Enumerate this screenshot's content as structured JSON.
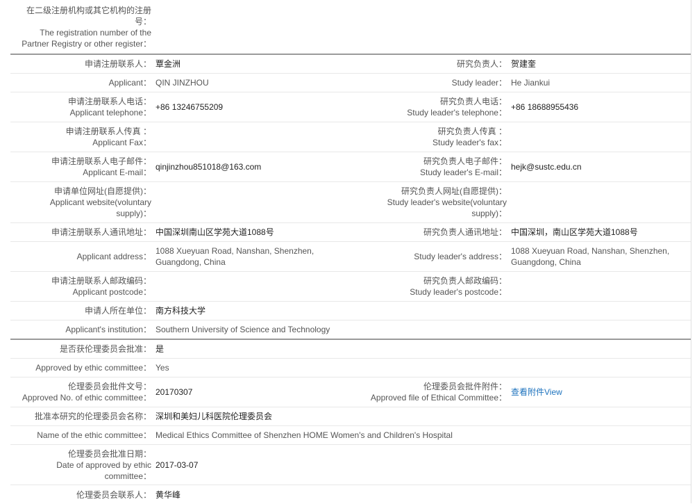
{
  "rows": [
    {
      "l1": [
        "在二级注册机构或其它机构的注册",
        "号：",
        "The registration number of the",
        "Partner Registry or other register："
      ],
      "v1": ""
    },
    {
      "l1": [
        "申请注册联系人："
      ],
      "v1": "覃金洲",
      "l2": [
        "研究负责人："
      ],
      "v2": "贺建奎"
    },
    {
      "l1": [
        "Applicant："
      ],
      "v1": "QIN JINZHOU",
      "l2": [
        "Study leader："
      ],
      "v2": "He Jiankui"
    },
    {
      "l1": [
        "申请注册联系人电话：",
        "Applicant telephone："
      ],
      "v1": "+86 13246755209",
      "l2": [
        "研究负责人电话：",
        "Study leader's telephone："
      ],
      "v2": "+86 18688955436"
    },
    {
      "l1": [
        "申请注册联系人传真 ：",
        "Applicant Fax："
      ],
      "v1": "",
      "l2": [
        "研究负责人传真 ：",
        "Study leader's fax："
      ],
      "v2": ""
    },
    {
      "l1": [
        "申请注册联系人电子邮件：",
        "Applicant E-mail："
      ],
      "v1": "qinjinzhou851018@163.com",
      "l2": [
        "研究负责人电子邮件：",
        "Study leader's E-mail："
      ],
      "v2": "hejk@sustc.edu.cn"
    },
    {
      "l1": [
        "申请单位网址(自愿提供)：",
        "Applicant website(voluntary",
        "supply)："
      ],
      "v1": "",
      "l2": [
        "研究负责人网址(自愿提供)：",
        "Study leader's website(voluntary",
        "supply)："
      ],
      "v2": ""
    },
    {
      "l1": [
        "申请注册联系人通讯地址："
      ],
      "v1": "中国深圳南山区学苑大道1088号",
      "l2": [
        "研究负责人通讯地址："
      ],
      "v2": "中国深圳，南山区学苑大道1088号"
    },
    {
      "l1": [
        "Applicant address："
      ],
      "v1": "1088 Xueyuan Road, Nanshan, Shenzhen, Guangdong, China",
      "l2": [
        "Study leader's address："
      ],
      "v2": "1088 Xueyuan Road, Nanshan, Shenzhen, Guangdong, China"
    },
    {
      "l1": [
        "申请注册联系人邮政编码：",
        "Applicant postcode："
      ],
      "v1": "",
      "l2": [
        "研究负责人邮政编码：",
        "Study leader's postcode："
      ],
      "v2": ""
    },
    {
      "l1": [
        "申请人所在单位："
      ],
      "v1": "南方科技大学"
    },
    {
      "l1": [
        "Applicant's institution："
      ],
      "v1": "Southern University of Science and Technology"
    },
    {
      "l1": [
        "是否获伦理委员会批准："
      ],
      "v1": "是"
    },
    {
      "l1": [
        "Approved by ethic committee："
      ],
      "v1": "Yes"
    },
    {
      "l1": [
        "伦理委员会批件文号：",
        "Approved No. of ethic committee："
      ],
      "v1": "20170307",
      "l2": [
        "伦理委员会批件附件：",
        "Approved file of Ethical Committee："
      ],
      "v2": "查看附件View"
    },
    {
      "l1": [
        "批准本研究的伦理委员会名称："
      ],
      "v1": "深圳和美妇儿科医院伦理委员会"
    },
    {
      "l1": [
        "Name of the ethic committee："
      ],
      "v1": "Medical Ethics Committee of Shenzhen HOME Women's and Children's Hospital"
    },
    {
      "l1": [
        "伦理委员会批准日期：",
        "Date of approved by ethic",
        "committee："
      ],
      "v1": "2017-03-07"
    },
    {
      "l1": [
        "伦理委员会联系人："
      ],
      "v1": "黄华峰"
    }
  ]
}
